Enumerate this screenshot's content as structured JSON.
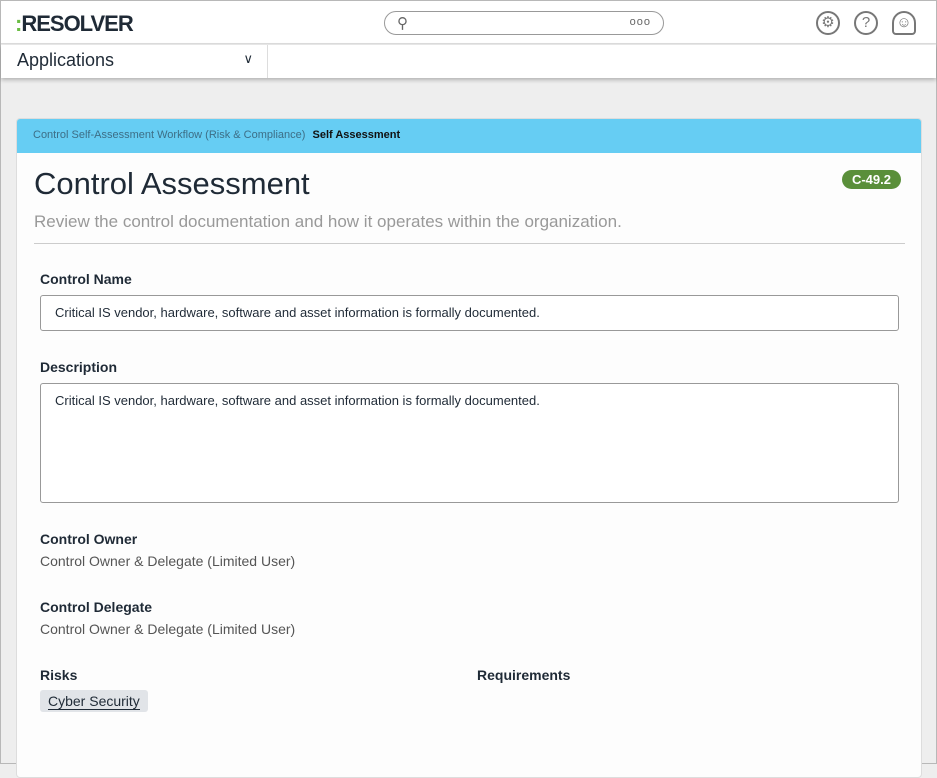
{
  "header": {
    "logo": "RESOLVER",
    "search_more": "ooo"
  },
  "nav": {
    "applications": "Applications"
  },
  "breadcrumb": {
    "parent": "Control Self-Assessment Workflow (Risk & Compliance)",
    "current": "Self Assessment"
  },
  "page": {
    "title": "Control Assessment",
    "badge": "C-49.2",
    "subtitle": "Review the control documentation and how it operates within the organization."
  },
  "fields": {
    "control_name_label": "Control Name",
    "control_name": "Critical IS vendor, hardware, software and asset information is formally documented.",
    "description_label": "Description",
    "description": "Critical IS vendor, hardware, software and asset information is formally documented.",
    "owner_label": "Control Owner",
    "owner": "Control Owner & Delegate (Limited User)",
    "delegate_label": "Control Delegate",
    "delegate": "Control Owner & Delegate (Limited User)",
    "risks_label": "Risks",
    "risk_tag": "Cyber Security",
    "requirements_label": "Requirements"
  }
}
